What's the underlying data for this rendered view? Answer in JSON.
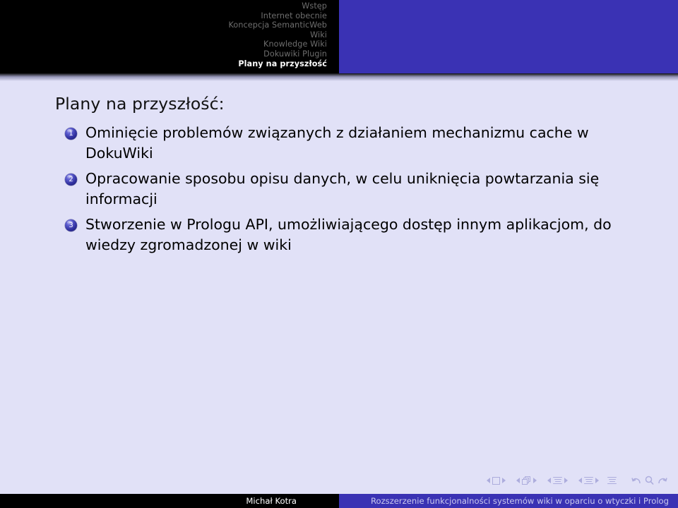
{
  "header": {
    "nav_items": [
      {
        "label": "Wstęp",
        "active": false
      },
      {
        "label": "Internet obecnie",
        "active": false
      },
      {
        "label": "Koncepcja SemanticWeb",
        "active": false
      },
      {
        "label": "Wiki",
        "active": false
      },
      {
        "label": "Knowledge Wiki",
        "active": false
      },
      {
        "label": "Dokuwiki Plugin",
        "active": false
      },
      {
        "label": "Plany na przyszłość",
        "active": true
      }
    ],
    "left_bg": "#000000",
    "right_bg": "#3a32b4"
  },
  "slide": {
    "title": "Plany na przyszłość:",
    "items": [
      {
        "number": "1",
        "text": "Ominięcie problemów związanych z działaniem mechanizmu cache w DokuWiki"
      },
      {
        "number": "2",
        "text": "Opracowanie sposobu opisu danych, w celu uniknięcia powtarzania się informacji"
      },
      {
        "number": "3",
        "text": "Stworzenie w Prologu API, umożliwiającego dostęp innym aplikacjom, do wiedzy zgromadzonej w wiki"
      }
    ],
    "background": "#e1e1f7"
  },
  "navigation_symbols": {
    "groups": [
      {
        "icon": "slide-icon",
        "prev": "prev-slide-arrow",
        "next": "next-slide-arrow"
      },
      {
        "icon": "frame-icon",
        "prev": "prev-frame-arrow",
        "next": "next-frame-arrow"
      },
      {
        "icon": "subsection-icon",
        "prev": "prev-subsection-arrow",
        "next": "next-subsection-arrow"
      },
      {
        "icon": "section-icon",
        "prev": "prev-section-arrow",
        "next": "next-section-arrow"
      }
    ],
    "document_icon": "document-icon",
    "back_icon": "back-icon",
    "search_icon": "search-icon",
    "forward_icon": "forward-icon"
  },
  "footer": {
    "author": "Michał Kotra",
    "title": "Rozszerzenie funkcjonalności systemów wiki w oparciu o wtyczki i Prolog",
    "left_bg": "#000000",
    "right_bg": "#3a32b4"
  }
}
